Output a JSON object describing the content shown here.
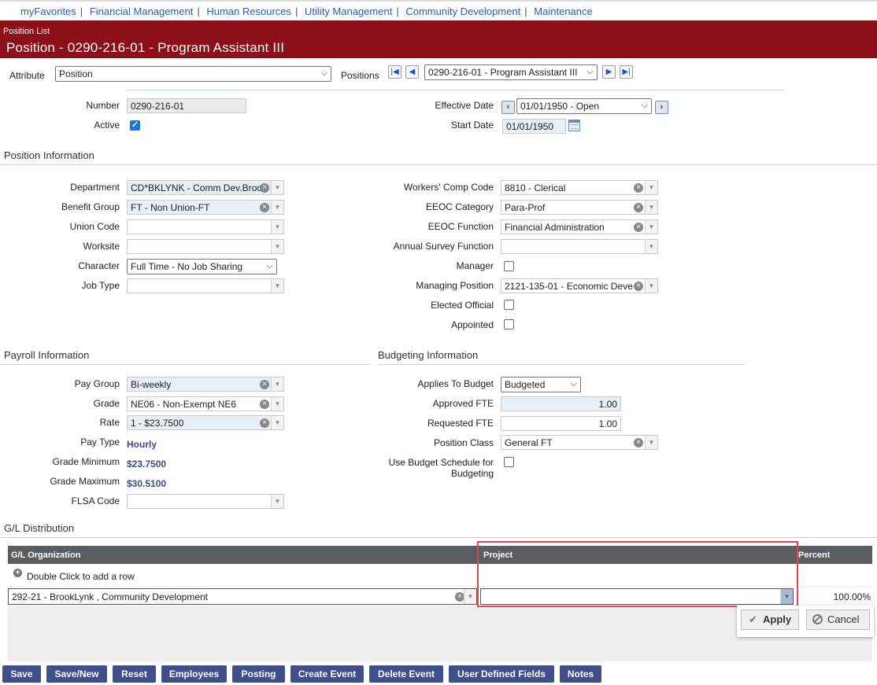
{
  "topnav": {
    "links": [
      "myFavorites",
      "Financial Management",
      "Human Resources",
      "Utility Management",
      "Community Development",
      "Maintenance"
    ]
  },
  "header": {
    "breadcrumb": "Position List",
    "title": "Position - 0290-216-01 - Program Assistant III"
  },
  "attribute_bar": {
    "attribute_label": "Attribute",
    "attribute_value": "Position",
    "positions_label": "Positions",
    "positions_value": "0290-216-01 - Program Assistant III"
  },
  "general": {
    "number_label": "Number",
    "number_value": "0290-216-01",
    "active_label": "Active",
    "active_checked": true,
    "effective_date_label": "Effective Date",
    "effective_date_value": "01/01/1950 - Open",
    "start_date_label": "Start Date",
    "start_date_value": "01/01/1950"
  },
  "position_information": {
    "title": "Position Information",
    "left": [
      {
        "label": "Department",
        "value": "CD*BKLYNK - Comm Dev.Broo"
      },
      {
        "label": "Benefit Group",
        "value": "FT - Non Union-FT"
      },
      {
        "label": "Union Code",
        "value": ""
      },
      {
        "label": "Worksite",
        "value": ""
      },
      {
        "label": "Character",
        "value": "Full Time - No Job Sharing"
      },
      {
        "label": "Job Type",
        "value": ""
      }
    ],
    "right": [
      {
        "label": "Workers' Comp Code",
        "value": "8810 - Clerical"
      },
      {
        "label": "EEOC Category",
        "value": "Para-Prof"
      },
      {
        "label": "EEOC Function",
        "value": "Financial Administration"
      },
      {
        "label": "Annual Survey Function",
        "value": ""
      },
      {
        "label": "Manager",
        "value": ""
      },
      {
        "label": "Managing Position",
        "value": "2121-135-01 - Economic Deve"
      },
      {
        "label": "Elected Official",
        "value": ""
      },
      {
        "label": "Appointed",
        "value": ""
      }
    ]
  },
  "payroll_information": {
    "title": "Payroll Information",
    "pay_group_label": "Pay Group",
    "pay_group_value": "Bi-weekly",
    "grade_label": "Grade",
    "grade_value": "NE06 - Non-Exempt NE6",
    "rate_label": "Rate",
    "rate_value": "1 - $23.7500",
    "pay_type_label": "Pay Type",
    "pay_type_value": "Hourly",
    "grade_min_label": "Grade Minimum",
    "grade_min_value": "$23.7500",
    "grade_max_label": "Grade Maximum",
    "grade_max_value": "$30.5100",
    "flsa_label": "FLSA Code",
    "flsa_value": ""
  },
  "budgeting_information": {
    "title": "Budgeting Information",
    "applies_label": "Applies To Budget",
    "applies_value": "Budgeted",
    "approved_fte_label": "Approved FTE",
    "approved_fte_value": "1.00",
    "requested_fte_label": "Requested FTE",
    "requested_fte_value": "1.00",
    "position_class_label": "Position Class",
    "position_class_value": "General FT",
    "use_budget_label_1": "Use Budget Schedule for",
    "use_budget_label_2": "Budgeting"
  },
  "gl_distribution": {
    "title": "G/L Distribution",
    "columns": [
      "G/L Organization",
      "Project",
      "Percent"
    ],
    "add_row_text": "Double Click to add a row",
    "row": {
      "organization": "292-21 - BrookLynk , Community Development",
      "project": "",
      "percent": "100.00%"
    },
    "apply_label": "Apply",
    "cancel_label": "Cancel"
  },
  "bottom_buttons": [
    "Save",
    "Save/New",
    "Reset",
    "Employees",
    "Posting",
    "Create Event",
    "Delete Event",
    "User Defined Fields",
    "Notes"
  ],
  "colors": {
    "header_bg": "#8b1019",
    "button_bg": "#3e4f8c",
    "highlight": "#e0474c"
  }
}
